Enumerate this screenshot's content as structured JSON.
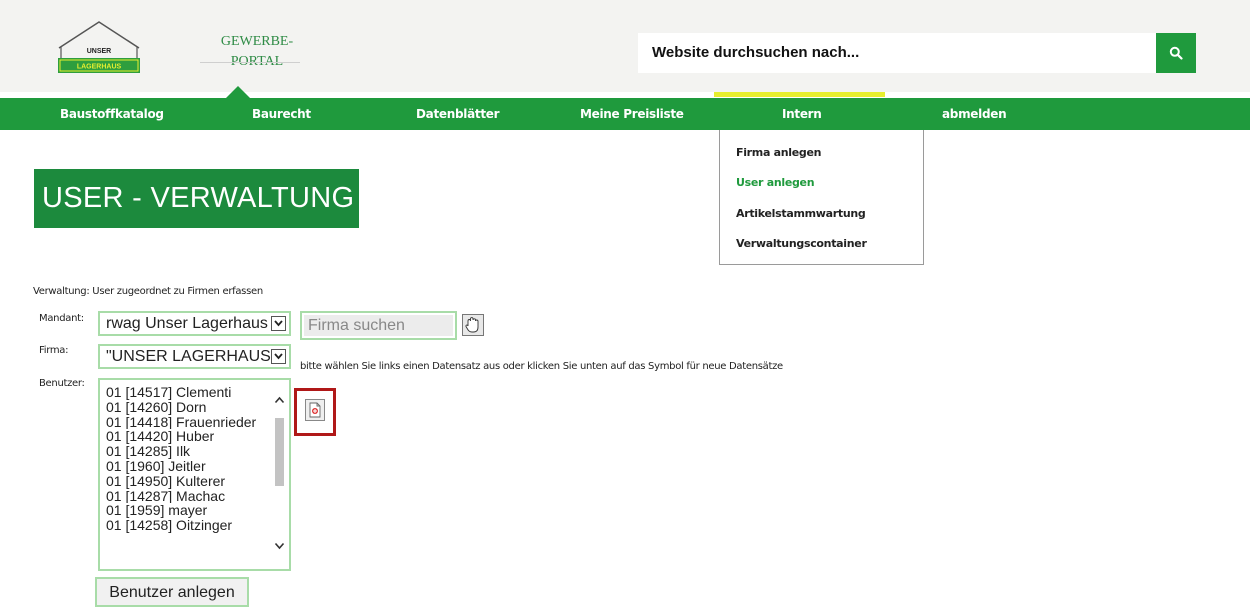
{
  "header": {
    "logo": {
      "line1": "UNSER",
      "line2": "LAGERHAUS"
    },
    "portal": {
      "line1": "GEWERBE-",
      "line2": "PORTAL"
    },
    "search": {
      "placeholder": "Website durchsuchen nach...",
      "icon": "search-icon"
    },
    "colors": {
      "brand_green": "#1f9a3d",
      "accent_yellow": "#e6ee2f"
    }
  },
  "nav": {
    "items": [
      {
        "label": "Baustoffkatalog"
      },
      {
        "label": "Baurecht"
      },
      {
        "label": "Datenblätter"
      },
      {
        "label": "Meine Preisliste"
      },
      {
        "label": "Intern",
        "active": true
      },
      {
        "label": "abmelden"
      }
    ]
  },
  "dropdown": {
    "items": [
      {
        "label": "Firma anlegen"
      },
      {
        "label": "User anlegen",
        "active": true
      },
      {
        "label": "Artikelstammwartung"
      },
      {
        "label": "Verwaltungscontainer"
      }
    ]
  },
  "page": {
    "title": "USER - VERWALTUNG",
    "description": "Verwaltung: User zugeordnet zu Firmen erfassen"
  },
  "form": {
    "mandant": {
      "label": "Mandant:",
      "value": "rwag Unser Lagerhaus"
    },
    "firma_search": {
      "placeholder": "Firma suchen"
    },
    "firma": {
      "label": "Firma:",
      "value": "\"UNSER LAGERHAUS"
    },
    "hint": "bitte wählen Sie links einen Datensatz aus oder klicken Sie unten auf das Symbol für neue Datensätze",
    "benutzer": {
      "label": "Benutzer:",
      "items": [
        "01 [14517] Clementi",
        "01 [14260] Dorn",
        "01 [14418] Frauenrieder",
        "01 [14420] Huber",
        "01 [14285] Ilk",
        "01 [1960] Jeitler",
        "01 [14950] Kulterer",
        "01 [14287] Machac",
        "01 [1959] mayer",
        "01 [14258] Oitzinger"
      ]
    },
    "add_user_button": "Benutzer anlegen"
  }
}
